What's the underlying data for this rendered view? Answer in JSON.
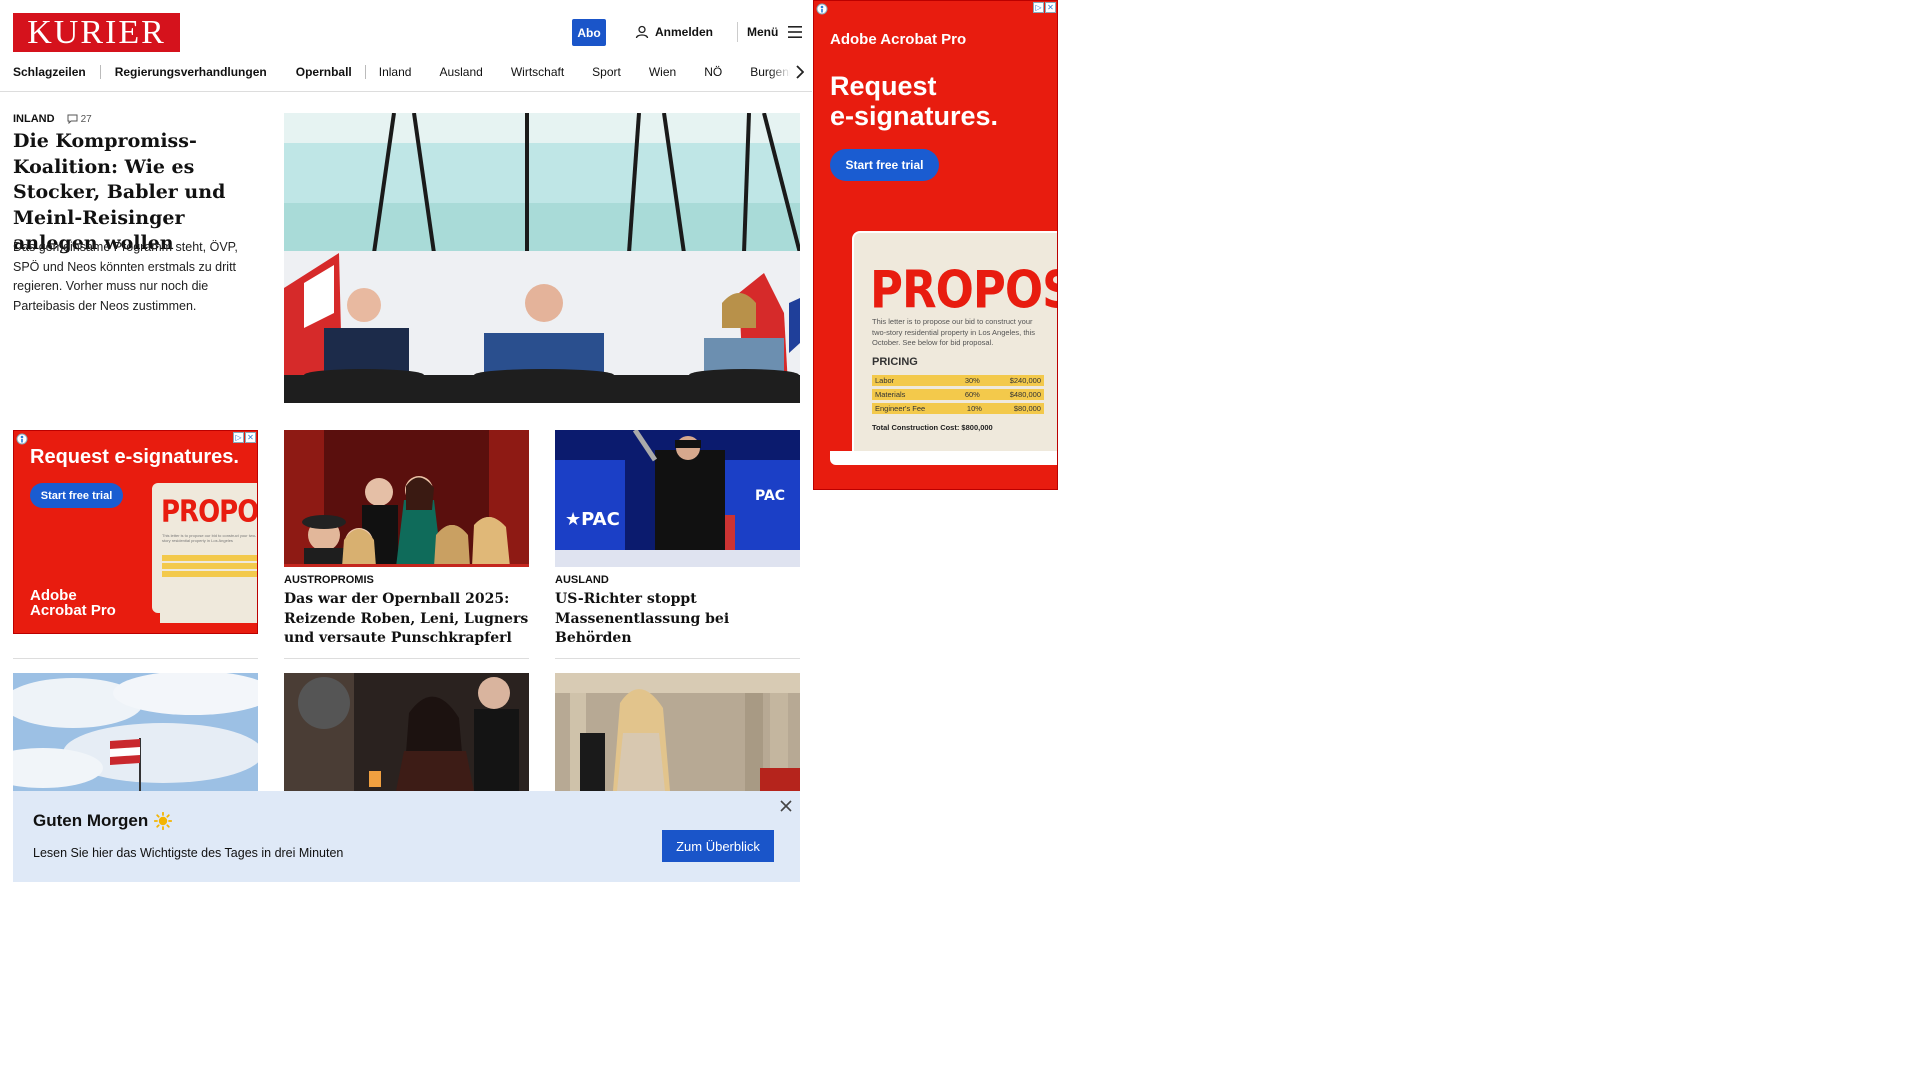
{
  "header": {
    "logo": "KURIER",
    "abo_label": "Abo",
    "login_label": "Anmelden",
    "menu_label": "Menü"
  },
  "nav": {
    "items": [
      "Schlagzeilen",
      "Regierungsverhandlungen",
      "Opernball",
      "Inland",
      "Ausland",
      "Wirtschaft",
      "Sport",
      "Wien",
      "NÖ",
      "Burgenla"
    ]
  },
  "lead": {
    "section": "INLAND",
    "comments": "27",
    "title": "Die Kompromiss-Koalition: Wie es Stocker, Babler und Meinl-Reisinger anlegen wollen",
    "teaser": "Das gemeinsame Programm steht, ÖVP, SPÖ und Neos könnten erstmals zu dritt regieren. Vorher muss nur noch die Parteibasis der Neos zustimmen."
  },
  "tiles": [
    {
      "section": "AUSTROPROMIS",
      "title": "Das war der Opernball 2025: Reizende Roben, Leni, Lugners und versaute Punschkrapferl"
    },
    {
      "section": "AUSLAND",
      "title": "US-Richter stoppt Massenentlassung bei Behörden"
    }
  ],
  "ad_small": {
    "headline": "Request e-signatures.",
    "cta": "Start free trial",
    "brand_line1": "Adobe",
    "brand_line2": "Acrobat Pro",
    "card_title": "PROPOSAL"
  },
  "ad_big": {
    "brand": "Adobe Acrobat Pro",
    "headline_line1": "Request",
    "headline_line2": "e-signatures.",
    "cta": "Start free trial",
    "card_title": "PROPOSAL",
    "card_body": "This letter is to propose our bid to construct your two-story residential property in Los Angeles, this October. See below for bid proposal.",
    "pricing_label": "PRICING",
    "rows": [
      {
        "item": "Labor",
        "pct": "30%",
        "amount": "$240,000"
      },
      {
        "item": "Materials",
        "pct": "60%",
        "amount": "$480,000"
      },
      {
        "item": "Engineer's Fee",
        "pct": "10%",
        "amount": "$80,000"
      }
    ],
    "total": "Total Construction Cost: $800,000"
  },
  "banner": {
    "title": "Guten Morgen",
    "icon": "sun-icon",
    "text": "Lesen Sie hier das Wichtigste des Tages in drei Minuten",
    "button": "Zum Überblick"
  },
  "colors": {
    "brand_red": "#d5121c",
    "abo_blue": "#1a55c9",
    "ad_red": "#e81c0f",
    "banner_bg": "#dfe9f7"
  }
}
